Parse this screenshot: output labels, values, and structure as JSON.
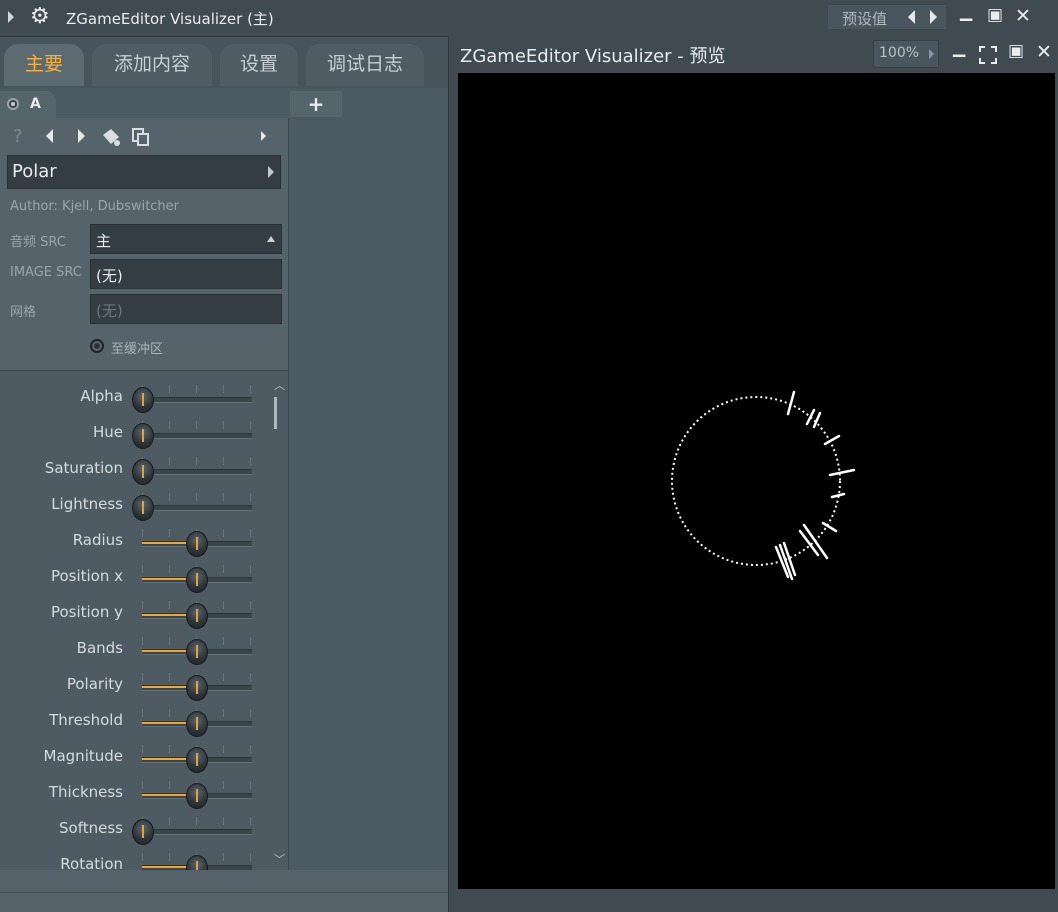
{
  "titlebar": {
    "title": "ZGameEditor Visualizer (主)",
    "preset_label": "预设值",
    "icons": [
      "menu-arrow-icon",
      "gear-icon",
      "prev-icon",
      "next-icon",
      "minimize-icon",
      "maximize-icon",
      "close-icon"
    ]
  },
  "tabs": [
    "主要",
    "添加内容",
    "设置",
    "调试日志"
  ],
  "layer_tab": {
    "label": "A",
    "add_label": "+"
  },
  "toolbar": {
    "help": "?",
    "icons": [
      "help-icon",
      "prev-preset-icon",
      "next-preset-icon",
      "bucket-icon",
      "copy-icon",
      "more-icon"
    ]
  },
  "preset": {
    "name": "Polar",
    "author": "Author: Kjell, Dubswitcher"
  },
  "fields": {
    "audio_label": "音频 SRC",
    "audio_value": "主",
    "image_label": "IMAGE SRC",
    "image_value": "(无)",
    "mesh_label": "网格",
    "mesh_value": "(无)",
    "buffer_label": "至缓冲区"
  },
  "sliders": [
    {
      "label": "Alpha",
      "value": 0.0
    },
    {
      "label": "Hue",
      "value": 0.0
    },
    {
      "label": "Saturation",
      "value": 0.0
    },
    {
      "label": "Lightness",
      "value": 0.0
    },
    {
      "label": "Radius",
      "value": 0.5
    },
    {
      "label": "Position x",
      "value": 0.5
    },
    {
      "label": "Position y",
      "value": 0.5
    },
    {
      "label": "Bands",
      "value": 0.5
    },
    {
      "label": "Polarity",
      "value": 0.5
    },
    {
      "label": "Threshold",
      "value": 0.5
    },
    {
      "label": "Magnitude",
      "value": 0.5
    },
    {
      "label": "Thickness",
      "value": 0.5
    },
    {
      "label": "Softness",
      "value": 0.0
    },
    {
      "label": "Rotation",
      "value": 0.5
    }
  ],
  "preview": {
    "title": "ZGameEditor Visualizer - 预览",
    "zoom": "100%"
  },
  "colors": {
    "accent": "#f0a62e",
    "canvas": "#000000",
    "panel": "#56636b"
  }
}
